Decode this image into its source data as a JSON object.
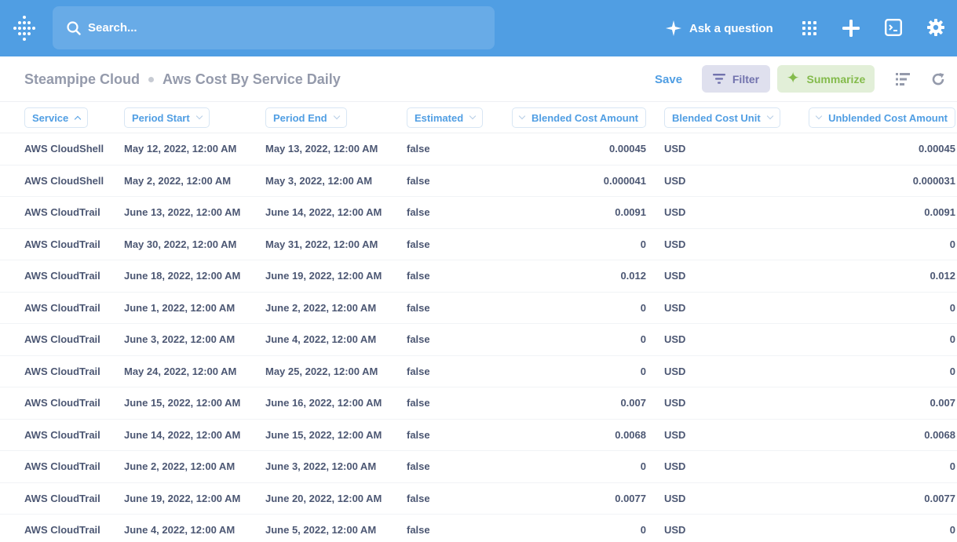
{
  "topbar": {
    "search_placeholder": "Search...",
    "ask_label": "Ask a question",
    "icons": [
      "metabase-logo-icon",
      "search-icon",
      "sparkle-icon",
      "grid-apps-icon",
      "plus-icon",
      "terminal-icon",
      "gear-icon"
    ],
    "bg_color": "#509ee3"
  },
  "subheader": {
    "breadcrumb_root": "Steampipe Cloud",
    "breadcrumb_current": "Aws Cost By Service Daily",
    "save_label": "Save",
    "filter_label": "Filter",
    "summarize_label": "Summarize"
  },
  "table": {
    "columns": [
      {
        "label": "Service",
        "sort": "asc"
      },
      {
        "label": "Period Start"
      },
      {
        "label": "Period End"
      },
      {
        "label": "Estimated"
      },
      {
        "label": "Blended Cost Amount"
      },
      {
        "label": "Blended Cost Unit"
      },
      {
        "label": "Unblended Cost Amount"
      }
    ],
    "rows": [
      [
        "AWS CloudShell",
        "May 12, 2022, 12:00 AM",
        "May 13, 2022, 12:00 AM",
        "false",
        "0.00045",
        "USD",
        "0.00045"
      ],
      [
        "AWS CloudShell",
        "May 2, 2022, 12:00 AM",
        "May 3, 2022, 12:00 AM",
        "false",
        "0.000041",
        "USD",
        "0.000031"
      ],
      [
        "AWS CloudTrail",
        "June 13, 2022, 12:00 AM",
        "June 14, 2022, 12:00 AM",
        "false",
        "0.0091",
        "USD",
        "0.0091"
      ],
      [
        "AWS CloudTrail",
        "May 30, 2022, 12:00 AM",
        "May 31, 2022, 12:00 AM",
        "false",
        "0",
        "USD",
        "0"
      ],
      [
        "AWS CloudTrail",
        "June 18, 2022, 12:00 AM",
        "June 19, 2022, 12:00 AM",
        "false",
        "0.012",
        "USD",
        "0.012"
      ],
      [
        "AWS CloudTrail",
        "June 1, 2022, 12:00 AM",
        "June 2, 2022, 12:00 AM",
        "false",
        "0",
        "USD",
        "0"
      ],
      [
        "AWS CloudTrail",
        "June 3, 2022, 12:00 AM",
        "June 4, 2022, 12:00 AM",
        "false",
        "0",
        "USD",
        "0"
      ],
      [
        "AWS CloudTrail",
        "May 24, 2022, 12:00 AM",
        "May 25, 2022, 12:00 AM",
        "false",
        "0",
        "USD",
        "0"
      ],
      [
        "AWS CloudTrail",
        "June 15, 2022, 12:00 AM",
        "June 16, 2022, 12:00 AM",
        "false",
        "0.007",
        "USD",
        "0.007"
      ],
      [
        "AWS CloudTrail",
        "June 14, 2022, 12:00 AM",
        "June 15, 2022, 12:00 AM",
        "false",
        "0.0068",
        "USD",
        "0.0068"
      ],
      [
        "AWS CloudTrail",
        "June 2, 2022, 12:00 AM",
        "June 3, 2022, 12:00 AM",
        "false",
        "0",
        "USD",
        "0"
      ],
      [
        "AWS CloudTrail",
        "June 19, 2022, 12:00 AM",
        "June 20, 2022, 12:00 AM",
        "false",
        "0.0077",
        "USD",
        "0.0077"
      ],
      [
        "AWS CloudTrail",
        "June 4, 2022, 12:00 AM",
        "June 5, 2022, 12:00 AM",
        "false",
        "0",
        "USD",
        "0"
      ]
    ]
  }
}
